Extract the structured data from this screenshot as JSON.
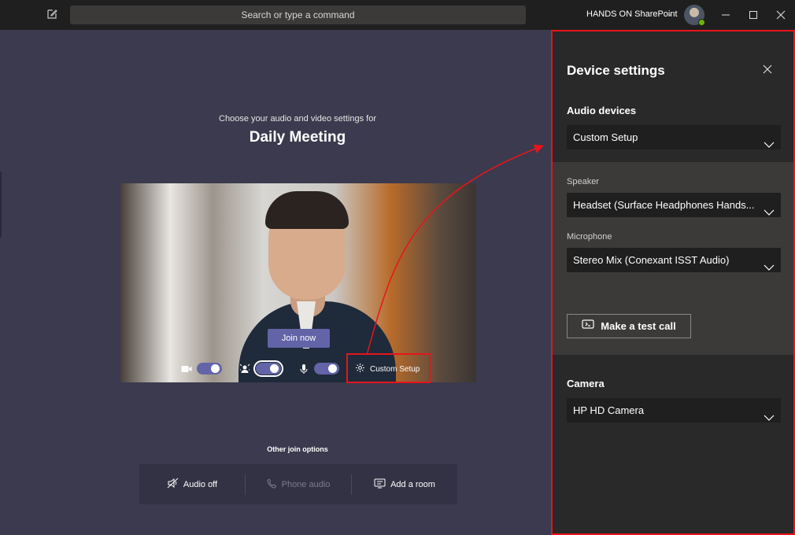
{
  "titlebar": {
    "search_placeholder": "Search or type a command",
    "tenant": "HANDS ON SharePoint",
    "icons": [
      "compose-icon",
      "chevron-down-icon",
      "minimize-icon",
      "maximize-icon",
      "close-icon"
    ]
  },
  "prejoin": {
    "pre_title": "Choose your audio and video settings for",
    "meeting_title": "Daily Meeting",
    "join_label": "Join now",
    "controls": {
      "camera_on": true,
      "blur_on": true,
      "mic_on": true,
      "custom_setup_label": "Custom Setup"
    },
    "other_join_title": "Other join options",
    "other_options": [
      {
        "label": "Audio off",
        "enabled": true
      },
      {
        "label": "Phone audio",
        "enabled": false
      },
      {
        "label": "Add a room",
        "enabled": true
      }
    ]
  },
  "device_settings": {
    "title": "Device settings",
    "audio_devices_heading": "Audio devices",
    "audio_device": "Custom Setup",
    "speaker_label": "Speaker",
    "speaker": "Headset (Surface Headphones Hands...",
    "microphone_label": "Microphone",
    "microphone": "Stereo Mix (Conexant ISST Audio)",
    "test_call_label": "Make a test call",
    "camera_heading": "Camera",
    "camera": "HP HD Camera"
  },
  "colors": {
    "accent": "#6264a7",
    "highlight": "#e8141c",
    "stage": "#3b3a4e",
    "panel": "#292929"
  }
}
